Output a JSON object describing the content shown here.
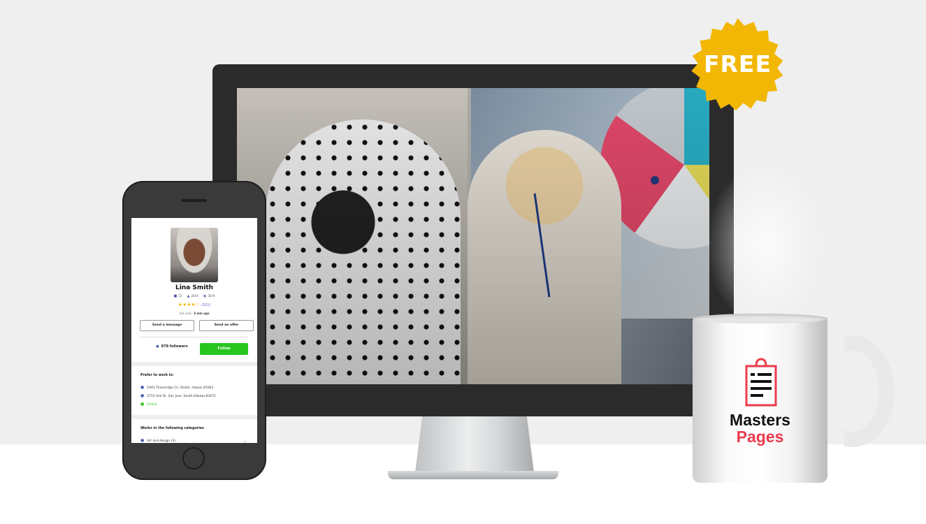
{
  "badge": {
    "text": "FREE",
    "color": "#f2b705"
  },
  "profile": {
    "name": "Lina Smith",
    "stats": [
      {
        "icon": "briefcase-icon",
        "value": "15"
      },
      {
        "icon": "thumbs-up-icon",
        "value": "2019"
      },
      {
        "icon": "eye-icon",
        "value": "3079"
      }
    ],
    "stars": "★★★★☆",
    "rating_value": 4.5,
    "rating_count": "(321)",
    "last_seen_label": "last seen:",
    "last_seen_value": "3 min ago",
    "send_message": "Send a message",
    "send_offer": "Send an offer",
    "followers": "878 followers",
    "follow": "Follow",
    "prefer_title": "Prefer to work in:",
    "locations": [
      "1901 Thornridge Cir. Shiloh, Hawaii 81063",
      "2715 Ash Dr. San Jose, South Dakota 83475",
      "Online"
    ],
    "categories_title": "Works in the following categories",
    "category_first": "Art and design (3)"
  },
  "mug": {
    "brand_line1": "Masters",
    "brand_line2": "Pages",
    "accent": "#ec3b4d"
  },
  "colors": {
    "follow_green": "#28c51f",
    "icon_blue": "#4a5ca8",
    "star_yellow": "#f2b705"
  }
}
